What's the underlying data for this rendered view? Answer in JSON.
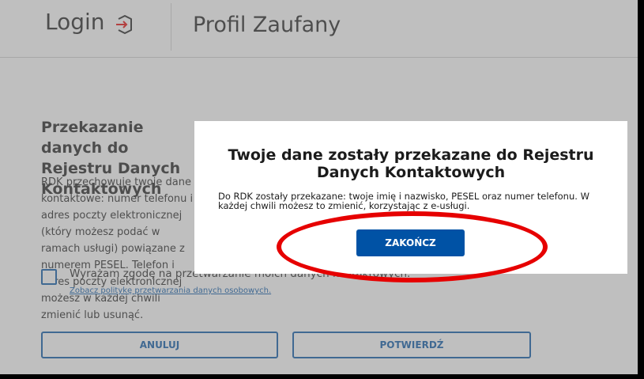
{
  "header": {
    "login_label": "Login",
    "profil_title": "Profil Zaufany"
  },
  "main": {
    "section_heading": "Przekazanie danych do Rejestru Danych Kontaktowych",
    "section_desc": "RDK przechowuje twoje dane kontaktowe: numer telefonu i adres poczty elektronicznej (który możesz podać w ramach usługi) powiązane z numerem PESEL. Telefon i adres poczty elektronicznej możesz w każdej chwili zmienić lub usunąć.",
    "consent_label": "Wyrażam zgodę na przetwarzanie moich danych kontaktowych.",
    "privacy_link": "Zobacz politykę przetwarzania danych osobowych.",
    "cancel_label": "ANULUJ",
    "confirm_label": "POTWIERDŹ"
  },
  "modal": {
    "title": "Twoje dane zostały przekazane do Rejestru Danych Kontaktowych",
    "text": "Do RDK zostały przekazane: twoje imię i nazwisko, PESEL oraz numer telefonu. W każdej chwili możesz to zmienić, korzystając z e-usługi.",
    "finish_label": "ZAKOŃCZ"
  },
  "colors": {
    "primary": "#0052a5",
    "annotation": "#e60000",
    "text": "#1b1b1b"
  },
  "icons": {
    "login": "login-arrow-icon"
  }
}
